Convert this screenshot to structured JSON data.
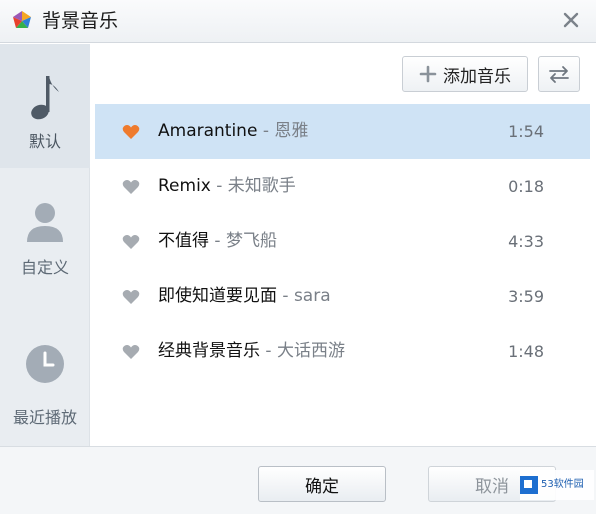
{
  "window": {
    "title": "背景音乐"
  },
  "colors": {
    "accent": "#ef7b2d",
    "heart_inactive": "#a6abb1",
    "selected_row": "#cfe3f5",
    "sidebar_bg": "#e9edf1"
  },
  "sidebar": {
    "items": [
      {
        "label": "默认",
        "icon": "music-note-icon",
        "active": true
      },
      {
        "label": "自定义",
        "icon": "person-icon",
        "active": false
      },
      {
        "label": "最近播放",
        "icon": "clock-icon",
        "active": false
      }
    ]
  },
  "toolbar": {
    "add_music_label": "添加音乐",
    "add_icon": "plus-icon",
    "switch_icon": "swap-arrows-icon"
  },
  "songs": [
    {
      "title": "Amarantine",
      "artist": " - 恩雅",
      "duration": "1:54",
      "favorite": true,
      "selected": true
    },
    {
      "title": "Remix",
      "artist": " - 未知歌手",
      "duration": "0:18",
      "favorite": false,
      "selected": false
    },
    {
      "title": "不值得",
      "artist": " - 梦飞船",
      "duration": "4:33",
      "favorite": false,
      "selected": false
    },
    {
      "title": "即使知道要见面",
      "artist": " - sara",
      "duration": "3:59",
      "favorite": false,
      "selected": false
    },
    {
      "title": "经典背景音乐",
      "artist": " - 大话西游",
      "duration": "1:48",
      "favorite": false,
      "selected": false
    }
  ],
  "footer": {
    "ok_label": "确定",
    "cancel_label": "取消"
  },
  "watermark": {
    "text": "53软件园"
  }
}
